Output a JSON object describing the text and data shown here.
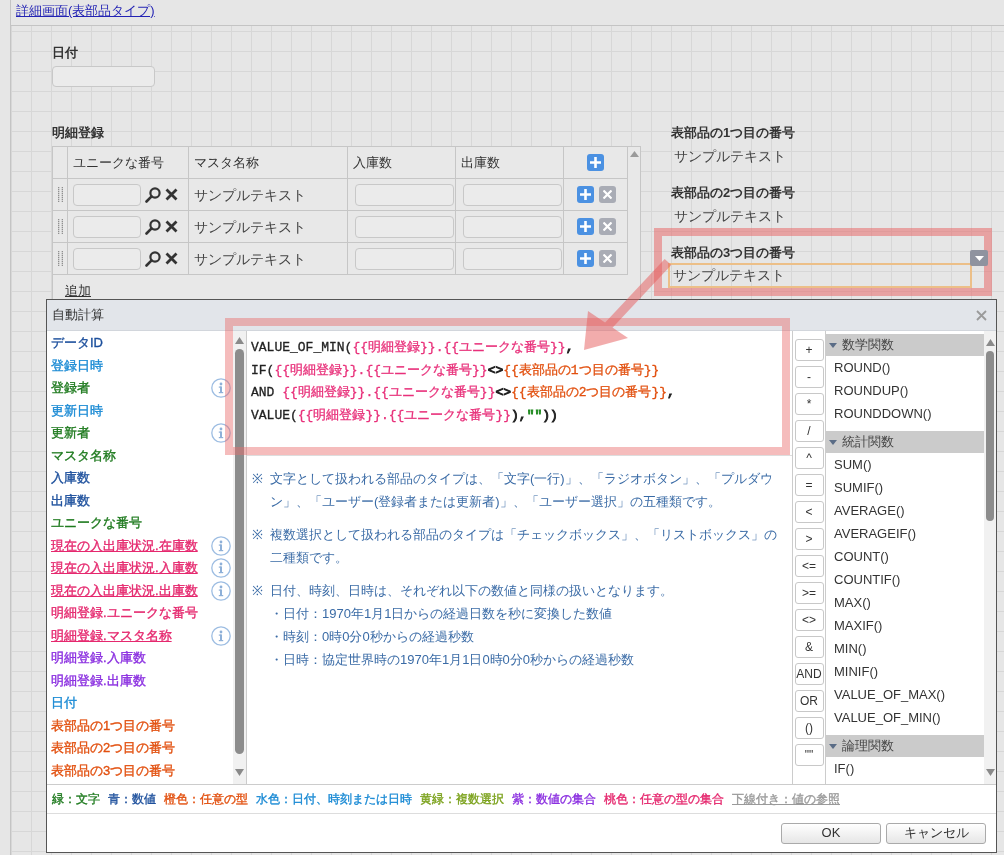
{
  "page": {
    "breadcrumb": "詳細画面(表部品タイプ)"
  },
  "form": {
    "date_field": {
      "label": "日付"
    },
    "detail_table": {
      "label": "明細登録",
      "columns": [
        "ユニークな番号",
        "マスタ名称",
        "入庫数",
        "出庫数"
      ],
      "rows": [
        {
          "master_name": "サンプルテキスト"
        },
        {
          "master_name": "サンプルテキスト"
        },
        {
          "master_name": "サンプルテキスト"
        }
      ],
      "add_link": "追加"
    },
    "table_part_fields": [
      {
        "label": "表部品の1つ目の番号",
        "value": "サンプルテキスト",
        "selected": false,
        "highlighted": false
      },
      {
        "label": "表部品の2つ目の番号",
        "value": "サンプルテキスト",
        "selected": false,
        "highlighted": false
      },
      {
        "label": "表部品の3つ目の番号",
        "value": "サンプルテキスト",
        "selected": true,
        "highlighted": true
      }
    ]
  },
  "dialog": {
    "title": "自動計算",
    "fields": [
      {
        "label": "データID",
        "color": "#1c4f9c",
        "underlined": false,
        "info": false
      },
      {
        "label": "登録日時",
        "color": "#1a8ad4",
        "underlined": false,
        "info": false
      },
      {
        "label": "登録者",
        "color": "#1e7a1e",
        "underlined": false,
        "info": true
      },
      {
        "label": "更新日時",
        "color": "#1a8ad4",
        "underlined": false,
        "info": false
      },
      {
        "label": "更新者",
        "color": "#1e7a1e",
        "underlined": false,
        "info": true
      },
      {
        "label": "マスタ名称",
        "color": "#1e7a1e",
        "underlined": false,
        "info": false
      },
      {
        "label": "入庫数",
        "color": "#1c4f9c",
        "underlined": false,
        "info": false
      },
      {
        "label": "出庫数",
        "color": "#1c4f9c",
        "underlined": false,
        "info": false
      },
      {
        "label": "ユニークな番号",
        "color": "#1e7a1e",
        "underlined": false,
        "info": false
      },
      {
        "label": "現在の入出庫状況.在庫数",
        "color": "#e5286e",
        "underlined": true,
        "info": true
      },
      {
        "label": "現在の入出庫状況.入庫数",
        "color": "#e5286e",
        "underlined": true,
        "info": true
      },
      {
        "label": "現在の入出庫状況.出庫数",
        "color": "#e5286e",
        "underlined": true,
        "info": true
      },
      {
        "label": "明細登録.ユニークな番号",
        "color": "#e5286e",
        "underlined": false,
        "info": false
      },
      {
        "label": "明細登録.マスタ名称",
        "color": "#e5286e",
        "underlined": true,
        "info": true
      },
      {
        "label": "明細登録.入庫数",
        "color": "#8a2ee0",
        "underlined": false,
        "info": false
      },
      {
        "label": "明細登録.出庫数",
        "color": "#8a2ee0",
        "underlined": false,
        "info": false
      },
      {
        "label": "日付",
        "color": "#1a8ad4",
        "underlined": false,
        "info": false
      },
      {
        "label": "表部品の1つ目の番号",
        "color": "#e2500f",
        "underlined": false,
        "info": false
      },
      {
        "label": "表部品の2つ目の番号",
        "color": "#e2500f",
        "underlined": false,
        "info": false
      },
      {
        "label": "表部品の3つ目の番号",
        "color": "#e2500f",
        "underlined": false,
        "info": false
      }
    ],
    "formula": {
      "highlighted": true,
      "lines": [
        {
          "segments": [
            {
              "text": "VALUE_OF_MIN(",
              "color": "#222222"
            },
            {
              "text": "{{明細登録}}.{{ユニークな番号}}",
              "color": "#e8307a"
            },
            {
              "text": ",",
              "color": "#222222"
            }
          ]
        },
        {
          "segments": [
            {
              "text": "IF(",
              "color": "#222222"
            },
            {
              "text": "{{明細登録}}.{{ユニークな番号}}",
              "color": "#e8307a"
            },
            {
              "text": "<>",
              "color": "#222222"
            },
            {
              "text": "{{表部品の1つ目の番号}}",
              "color": "#e2500f"
            }
          ]
        },
        {
          "segments": [
            {
              "text": "AND ",
              "color": "#222222"
            },
            {
              "text": "{{明細登録}}.{{ユニークな番号}}",
              "color": "#e8307a"
            },
            {
              "text": "<>",
              "color": "#222222"
            },
            {
              "text": "{{表部品の2つ目の番号}}",
              "color": "#e2500f"
            },
            {
              "text": ",",
              "color": "#222222"
            }
          ]
        },
        {
          "segments": [
            {
              "text": "VALUE(",
              "color": "#222222"
            },
            {
              "text": "{{明細登録}}.{{ユニークな番号}}",
              "color": "#e8307a"
            },
            {
              "text": "),",
              "color": "#222222"
            },
            {
              "text": "\"\"",
              "color": "#1f8a1f"
            },
            {
              "text": "))",
              "color": "#222222"
            }
          ]
        }
      ]
    },
    "notes": [
      {
        "mark": "※",
        "text": "文字として扱われる部品のタイプは、「文字(一行)」、「ラジオボタン」、「プルダウン」、「ユーザー(登録者または更新者)」、「ユーザー選択」の五種類です。"
      },
      {
        "mark": "※",
        "text": "複数選択として扱われる部品のタイプは「チェックボックス」、「リストボックス」の二種類です。"
      },
      {
        "mark": "※",
        "text": "日付、時刻、日時は、それぞれ以下の数値と同様の扱いとなります。",
        "sub_items": [
          "・日付：1970年1月1日からの経過日数を秒に変換した数値",
          "・時刻：0時0分0秒からの経過秒数",
          "・日時：協定世界時の1970年1月1日0時0分0秒からの経過秒数"
        ]
      }
    ],
    "operators": [
      "+",
      "-",
      "*",
      "/",
      "^",
      "=",
      "<",
      ">",
      "<=",
      ">=",
      "<>",
      "&",
      "AND",
      "OR",
      "()",
      "\"\""
    ],
    "function_groups": [
      {
        "name": "数学関数",
        "expanded": true,
        "items": [
          "ROUND()",
          "ROUNDUP()",
          "ROUNDDOWN()"
        ]
      },
      {
        "name": "統計関数",
        "expanded": true,
        "items": [
          "SUM()",
          "SUMIF()",
          "AVERAGE()",
          "AVERAGEIF()",
          "COUNT()",
          "COUNTIF()",
          "MAX()",
          "MAXIF()",
          "MIN()",
          "MINIF()",
          "VALUE_OF_MAX()",
          "VALUE_OF_MIN()"
        ]
      },
      {
        "name": "論理関数",
        "expanded": true,
        "items": [
          "IF()"
        ]
      }
    ],
    "legend": [
      {
        "text": "緑：文字",
        "color": "#1e7a1e",
        "underlined": false
      },
      {
        "text": "青：数値",
        "color": "#1c4f9c",
        "underlined": false
      },
      {
        "text": "橙色：任意の型",
        "color": "#e2500f",
        "underlined": false
      },
      {
        "text": "水色：日付、時刻または日時",
        "color": "#1a8ad4",
        "underlined": false
      },
      {
        "text": "黄緑：複数選択",
        "color": "#7aa11a",
        "underlined": false
      },
      {
        "text": "紫：数値の集合",
        "color": "#8a2ee0",
        "underlined": false
      },
      {
        "text": "桃色：任意の型の集合",
        "color": "#e5286e",
        "underlined": false
      },
      {
        "text": "下線付き：値の参照",
        "color": "#9a9a9a",
        "underlined": true
      }
    ],
    "buttons": [
      "OK",
      "キャンセル"
    ]
  }
}
